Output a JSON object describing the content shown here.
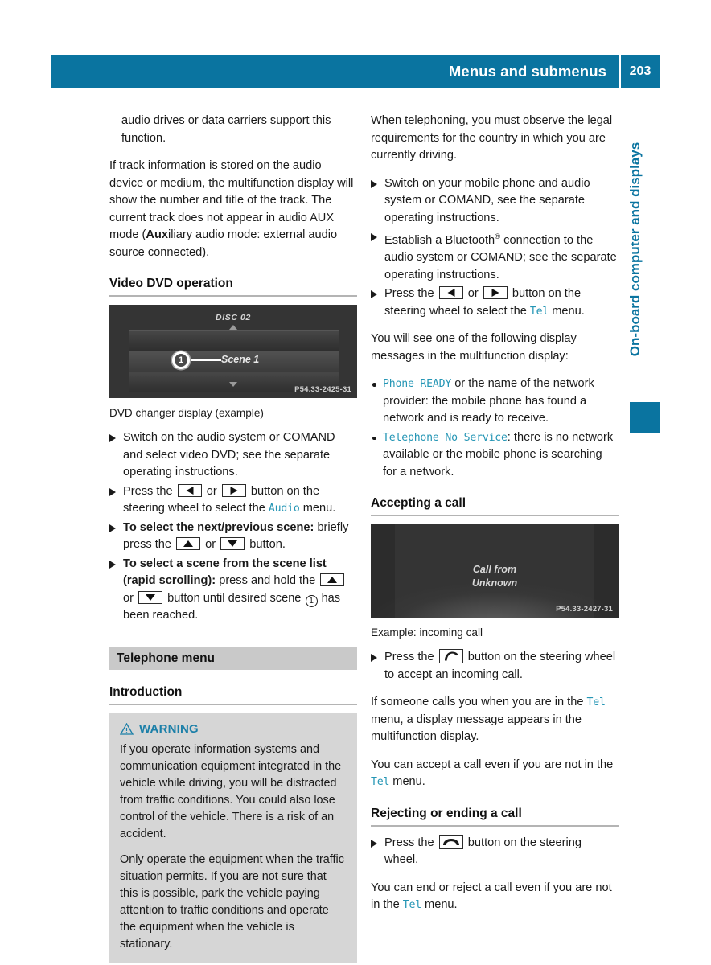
{
  "header": {
    "title": "Menus and submenus",
    "page_number": "203"
  },
  "side_tab": {
    "label": "On-board computer and displays"
  },
  "left_column": {
    "para_continued": "audio drives or data carriers support this function.",
    "para_track_info": "If track information is stored on the audio device or medium, the multifunction display will show the number and title of the track. The current track does not appear in audio AUX mode (",
    "para_track_info_bold": "Aux",
    "para_track_info_end": "iliary audio mode: external audio source connected).",
    "video_dvd_heading": "Video DVD operation",
    "dvd_figure": {
      "disc_label": "DISC 02",
      "scene_label": "Scene 1",
      "callout_number": "1",
      "watermark": "P54.33-2425-31",
      "caption": "DVD changer display (example)"
    },
    "steps": {
      "step1": "Switch on the audio system or COMAND and select video DVD; see the separate operating instructions.",
      "step2_a": "Press the",
      "step2_or": "or",
      "step2_b": "button on the steering wheel to select the",
      "step2_menu": "Audio",
      "step2_c": "menu.",
      "step3_bold": "To select the next/previous scene:",
      "step3_a": "briefly press the",
      "step3_or": "or",
      "step3_b": "button.",
      "step4_bold_line1": "To select a scene from the scene list",
      "step4_bold_line2": "(rapid scrolling):",
      "step4_a": "press and hold the",
      "step4_or": "or",
      "step4_b": "button until desired scene",
      "step4_callout": "1",
      "step4_c": "has been reached."
    },
    "telephone_menu_heading": "Telephone menu",
    "introduction_heading": "Introduction",
    "warning": {
      "icon": "warning-triangle-icon",
      "title": "WARNING",
      "para1": "If you operate information systems and communication equipment integrated in the vehicle while driving, you will be distracted from traffic conditions. You could also lose control of the vehicle. There is a risk of an accident.",
      "para2": "Only operate the equipment when the traffic situation permits. If you are not sure that this is possible, park the vehicle paying attention to traffic conditions and operate the equipment when the vehicle is stationary."
    }
  },
  "right_column": {
    "para_telephoning": "When telephoning, you must observe the legal requirements for the country in which you are currently driving.",
    "steps": {
      "step1": "Switch on your mobile phone and audio system or COMAND, see the separate operating instructions.",
      "step2_a": "Establish a Bluetooth",
      "step2_sup": "®",
      "step2_b": " connection to the audio system or COMAND; see the separate operating instructions.",
      "step3_a": "Press the",
      "step3_or": "or",
      "step3_b": "button on the steering wheel to select the",
      "step3_menu": "Tel",
      "step3_c": "menu."
    },
    "para_messages": "You will see one of the following display messages in the multifunction display:",
    "bullets": [
      {
        "display_text": "Phone READY",
        "rest": " or the name of the network provider: the mobile phone has found a network and is ready to receive."
      },
      {
        "display_text": "Telephone No Service",
        "rest": ": there is no network available or the mobile phone is searching for a network."
      }
    ],
    "accepting_heading": "Accepting a call",
    "call_figure": {
      "line1": "Call from",
      "line2": "Unknown",
      "watermark": "P54.33-2427-31",
      "caption": "Example: incoming call"
    },
    "accept_step": {
      "a": "Press the",
      "icon": "phone-accept-icon",
      "b": "button on the steering wheel to accept an incoming call."
    },
    "para_someone_calls_a": "If someone calls you when you are in the",
    "para_someone_calls_menu": "Tel",
    "para_someone_calls_b": "menu, a display message appears in the multifunction display.",
    "para_accept_not_in_a": "You can accept a call even if you are not in the",
    "para_accept_not_in_menu": "Tel",
    "para_accept_not_in_b": "menu.",
    "rejecting_heading": "Rejecting or ending a call",
    "reject_step": {
      "a": "Press the",
      "icon": "phone-hangup-icon",
      "b": "button on the steering wheel."
    },
    "para_end_reject_a": "You can end or reject a call even if you are not in the",
    "para_end_reject_menu": "Tel",
    "para_end_reject_b": "menu."
  },
  "colors": {
    "brand_blue": "#0a74a0",
    "display_teal": "#2596b5",
    "warning_blue": "#1b7fa8",
    "section_bar_gray": "#c9c9c9",
    "warning_box_gray": "#d6d6d6"
  }
}
